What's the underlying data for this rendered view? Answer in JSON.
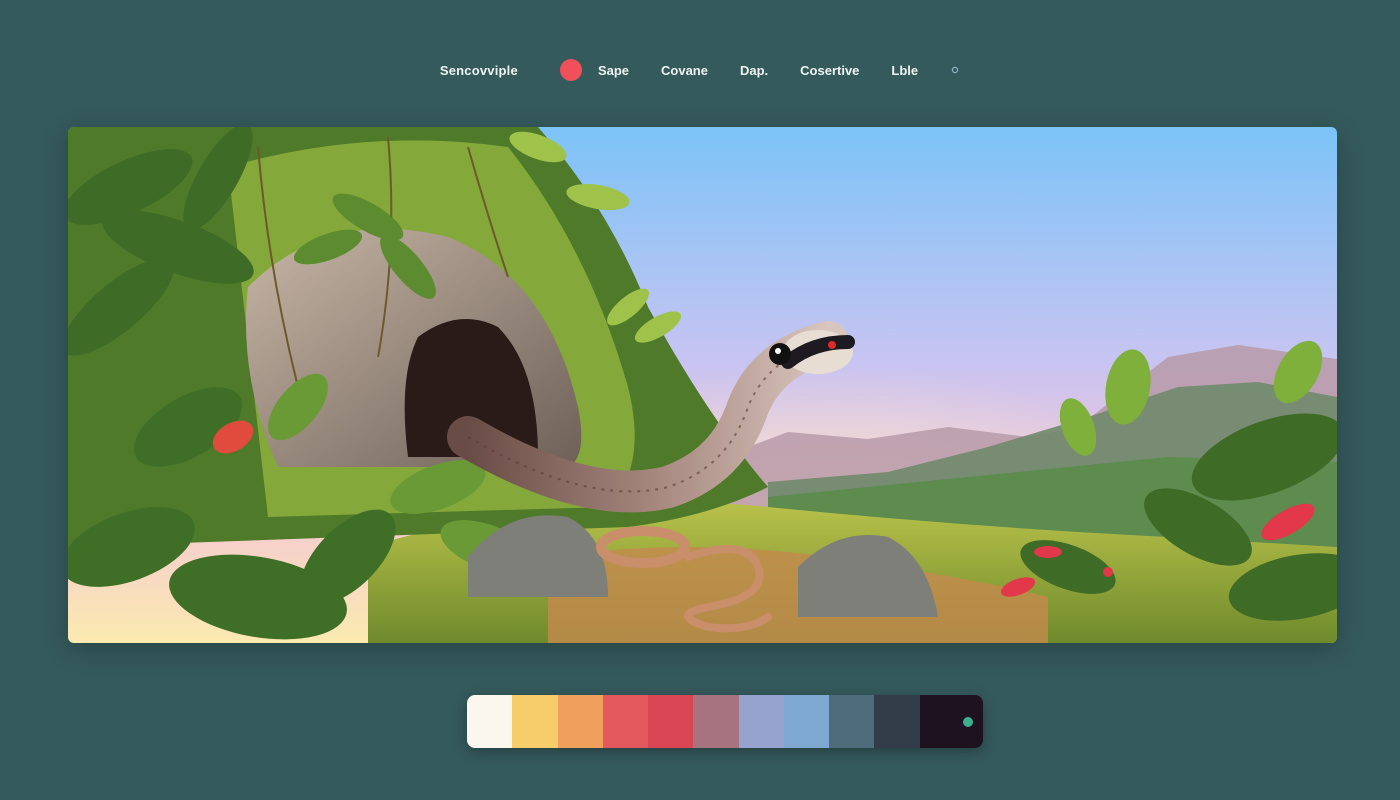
{
  "nav": {
    "brand": "Sencovviple",
    "accent_dot_color": "#f0505a",
    "items": [
      "Sape",
      "Covane",
      "Dap.",
      "Cosertive",
      "Lble"
    ],
    "trailing_icon": "small-circle-icon"
  },
  "hero": {
    "subject": "snake emerging from mossy cave in jungle at sunset"
  },
  "palette": {
    "swatches": [
      "#fbf7ee",
      "#f7cd6b",
      "#f0a05c",
      "#e2585d",
      "#d94552",
      "#a6737e",
      "#96a3cf",
      "#7ea8d0",
      "#4f6c7a",
      "#333d4a",
      "#1e1220"
    ],
    "indicator_color": "#3bb08f"
  }
}
